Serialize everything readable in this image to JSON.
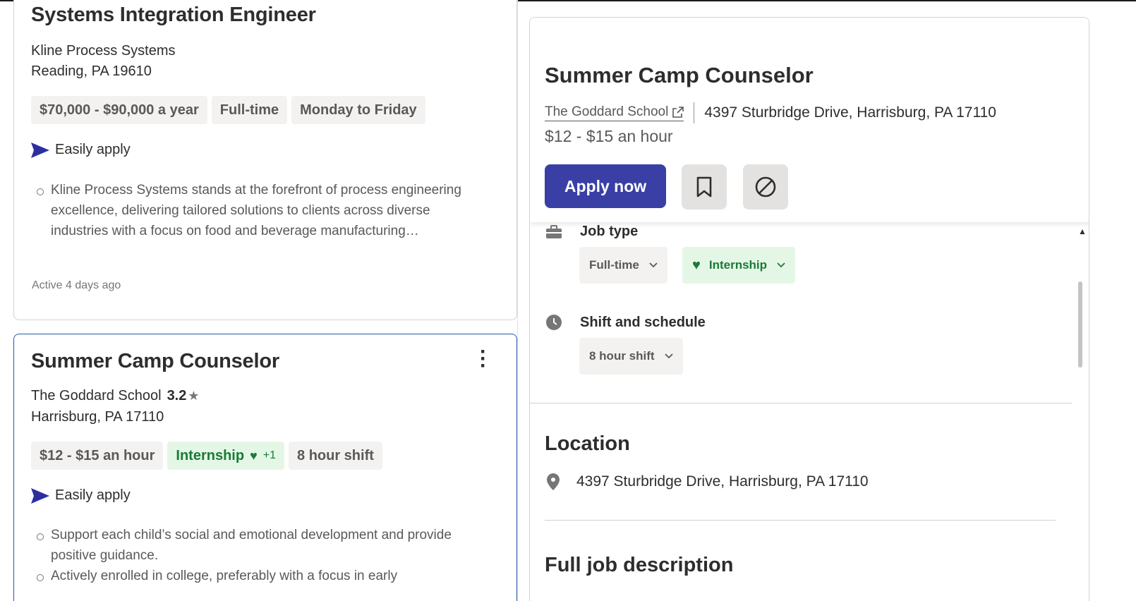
{
  "listing1": {
    "title": "Systems Integration Engineer",
    "company": "Kline Process Systems",
    "location": "Reading, PA 19610",
    "tags": [
      "$70,000 - $90,000 a year",
      "Full-time",
      "Monday to Friday"
    ],
    "easily_apply": "Easily apply",
    "bullets": [
      "Kline Process Systems stands at the forefront of process engineering excellence, delivering tailored solutions to clients across diverse industries with a focus on food and beverage manufacturing…"
    ],
    "active": "Active 4 days ago"
  },
  "listing2": {
    "title": "Summer Camp Counselor",
    "company": "The Goddard School",
    "rating": "3.2",
    "location": "Harrisburg, PA 17110",
    "tag_pay": "$12 - $15 an hour",
    "tag_internship": "Internship",
    "tag_plus": "+1",
    "tag_shift": "8 hour shift",
    "easily_apply": "Easily apply",
    "bullets": [
      "Support each child’s social and emotional development and provide positive guidance.",
      "Actively enrolled in college, preferably with a focus in early"
    ]
  },
  "detail": {
    "title": "Summer Camp Counselor",
    "company": "The Goddard School",
    "address": "4397 Sturbridge Drive, Harrisburg, PA 17110",
    "pay": "$12 - $15 an hour",
    "apply_label": "Apply now",
    "job_type_label": "Job type",
    "job_type_chips": [
      "Full-time",
      "Internship"
    ],
    "shift_label": "Shift and schedule",
    "shift_chips": [
      "8 hour shift"
    ],
    "location_title": "Location",
    "location_address": "4397 Sturbridge Drive, Harrisburg, PA 17110",
    "full_description_title": "Full job description"
  },
  "colors": {
    "apply_button": "#3a3fa6",
    "green_tag_bg": "#e4f7e6",
    "green_tag_text": "#1a7a36",
    "selected_card_border": "#2557a7"
  },
  "icons": [
    "send-icon",
    "star-icon",
    "heart-icon",
    "kebab-menu-icon",
    "external-link-icon",
    "bookmark-icon",
    "block-icon",
    "briefcase-icon",
    "clock-icon",
    "chevron-down-icon",
    "location-pin-icon"
  ]
}
